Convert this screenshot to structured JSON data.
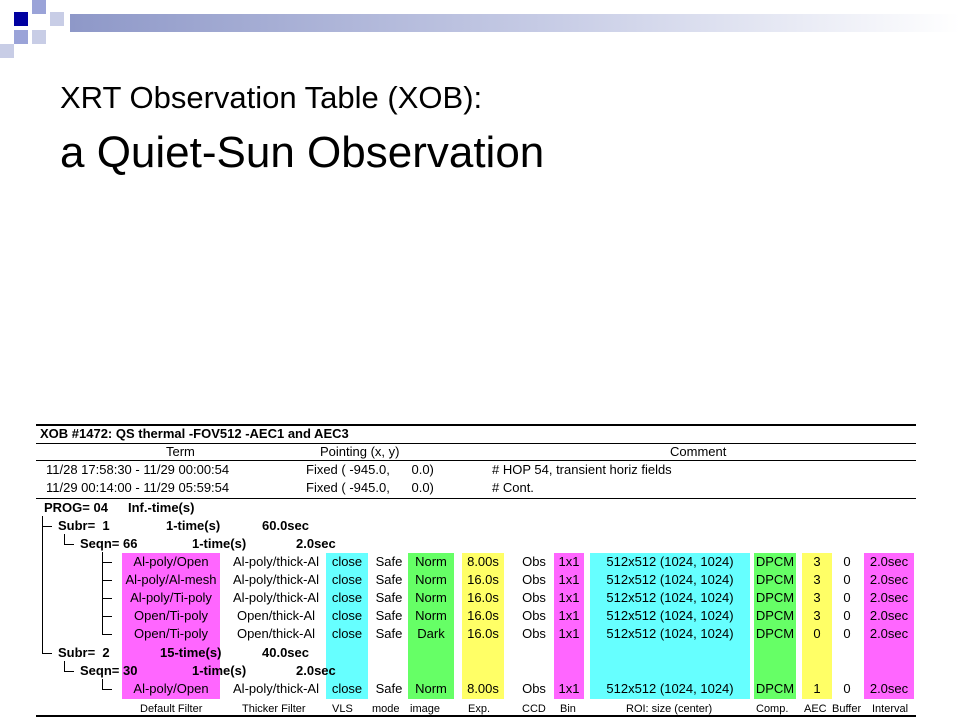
{
  "slide": {
    "title_line1": "XRT Observation Table (XOB):",
    "title_line2": "a Quiet-Sun Observation"
  },
  "colors": {
    "magenta": "#ff66ff",
    "cyan": "#66ffff",
    "green": "#66ff66",
    "yellow": "#ffff66",
    "deco_blue": "#0000a0",
    "deco_light": "#9aa3d8"
  },
  "xob": {
    "header": "XOB #1472: QS thermal -FOV512 -AEC1 and AEC3",
    "columns": [
      "Term",
      "Pointing (x, y)",
      "Comment"
    ],
    "terms": [
      {
        "term": "11/28 17:58:30 - 11/29 00:00:54",
        "pointing": "Fixed ( -945.0,      0.0)",
        "comment": "# HOP 54, transient horiz fields"
      },
      {
        "term": "11/29 00:14:00 - 11/29 05:59:54",
        "pointing": "Fixed ( -945.0,      0.0)",
        "comment": "# Cont."
      }
    ],
    "prog": {
      "label": "PROG= 04",
      "time": "Inf.-time(s)"
    },
    "subr1": {
      "label": "Subr=  1",
      "times": "1-time(s)",
      "interval": "60.0sec"
    },
    "seq1": {
      "label": "Seqn= 66",
      "times": "1-time(s)",
      "interval": "2.0sec"
    },
    "subr2": {
      "label": "Subr=  2",
      "times": "15-time(s)",
      "interval": "40.0sec"
    },
    "seq2": {
      "label": "Seqn= 30",
      "times": "1-time(s)",
      "interval": "2.0sec"
    },
    "rows": [
      {
        "filter": "Al-poly/Open",
        "thick": "Al-poly/thick-Al",
        "vls": "close",
        "mode": "Safe",
        "image": "Norm",
        "exp": "8.00s",
        "ccd": "Obs",
        "bin": "1x1",
        "roi": "512x512 (1024, 1024)",
        "comp": "DPCM",
        "aec": "3",
        "buffer": "0",
        "interval": "2.0sec"
      },
      {
        "filter": "Al-poly/Al-mesh",
        "thick": "Al-poly/thick-Al",
        "vls": "close",
        "mode": "Safe",
        "image": "Norm",
        "exp": "16.0s",
        "ccd": "Obs",
        "bin": "1x1",
        "roi": "512x512 (1024, 1024)",
        "comp": "DPCM",
        "aec": "3",
        "buffer": "0",
        "interval": "2.0sec"
      },
      {
        "filter": "Al-poly/Ti-poly",
        "thick": "Al-poly/thick-Al",
        "vls": "close",
        "mode": "Safe",
        "image": "Norm",
        "exp": "16.0s",
        "ccd": "Obs",
        "bin": "1x1",
        "roi": "512x512 (1024, 1024)",
        "comp": "DPCM",
        "aec": "3",
        "buffer": "0",
        "interval": "2.0sec"
      },
      {
        "filter": "Open/Ti-poly",
        "thick": "Open/thick-Al",
        "vls": "close",
        "mode": "Safe",
        "image": "Norm",
        "exp": "16.0s",
        "ccd": "Obs",
        "bin": "1x1",
        "roi": "512x512 (1024, 1024)",
        "comp": "DPCM",
        "aec": "3",
        "buffer": "0",
        "interval": "2.0sec"
      },
      {
        "filter": "Open/Ti-poly",
        "thick": "Open/thick-Al",
        "vls": "close",
        "mode": "Safe",
        "image": "Dark",
        "exp": "16.0s",
        "ccd": "Obs",
        "bin": "1x1",
        "roi": "512x512 (1024, 1024)",
        "comp": "DPCM",
        "aec": "0",
        "buffer": "0",
        "interval": "2.0sec"
      },
      {
        "filter": "Al-poly/Open",
        "thick": "Al-poly/thick-Al",
        "vls": "close",
        "mode": "Safe",
        "image": "Norm",
        "exp": "8.00s",
        "ccd": "Obs",
        "bin": "1x1",
        "roi": "512x512 (1024, 1024)",
        "comp": "DPCM",
        "aec": "1",
        "buffer": "0",
        "interval": "2.0sec"
      }
    ],
    "footer": [
      "Default Filter",
      "Thicker Filter",
      "VLS",
      "mode",
      "image",
      "Exp.",
      "CCD",
      "Bin",
      "ROI: size (center)",
      "Comp.",
      "AEC",
      "Buffer",
      "Interval"
    ]
  }
}
